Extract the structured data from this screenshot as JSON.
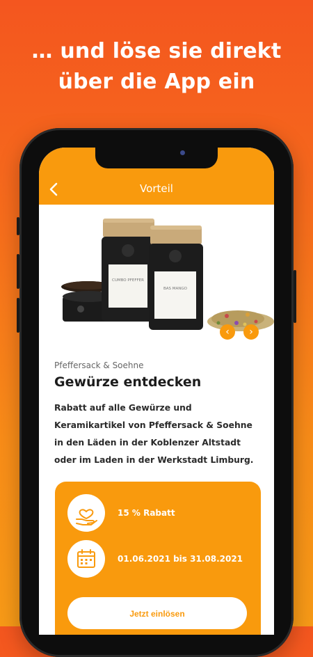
{
  "headline": {
    "line1": "… und löse sie direkt",
    "line2": "über die App ein"
  },
  "appbar": {
    "title": "Vorteil",
    "back_icon": "chevron-left-icon"
  },
  "product": {
    "jar_left_label": "CUMBO PFEFFER",
    "jar_right_label": "BAS MANGO"
  },
  "offer": {
    "brand": "Pfeffersack & Soehne",
    "title": "Gewürze entdecken",
    "description": "Rabatt auf alle Gewürze und Keramikartikel von Pfeffersack & Soehne in den Läden in der Koblenzer Altstadt oder im Laden in der Werkstadt Limburg."
  },
  "card": {
    "discount_text": "15 % Rabatt",
    "discount_icon": "heart-hand-icon",
    "date_text": "01.06.2021 bis 31.08.2021",
    "date_icon": "calendar-icon",
    "redeem_label": "Jetzt einlösen"
  },
  "colors": {
    "accent": "#f99a0d",
    "background_top": "#f4561f",
    "background_bottom": "#f79a17"
  }
}
